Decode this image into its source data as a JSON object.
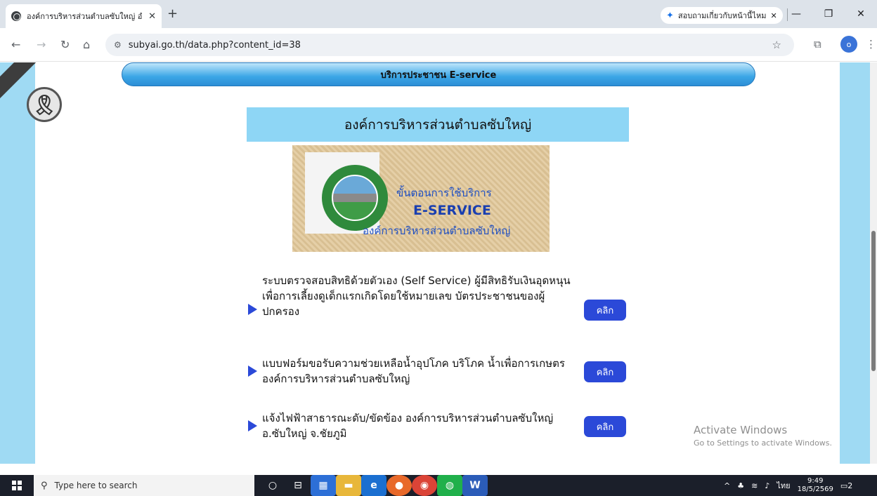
{
  "browser": {
    "tab_title": "องค์การบริหารส่วนตำบลซับใหญ่ อำเ",
    "tab_close": "✕",
    "new_tab": "+",
    "gemini_chip": "สอบถามเกี่ยวกับหน้านี้ไหม",
    "gemini_close": "✕",
    "url": "subyai.go.th/data.php?content_id=38",
    "profile_initial": "o"
  },
  "page": {
    "eservice_bar": "บริการประชาชน E-service",
    "org_header": "องค์การบริหารส่วนตำบลซับใหญ่",
    "banner": {
      "line1": "ขั้นตอนการใช้บริการ",
      "line2": "E-SERVICE",
      "line3": "องค์การบริหารส่วนตำบลซับใหญ่"
    },
    "services": [
      {
        "text": "ระบบตรวจสอบสิทธิด้วยตัวเอง (Self Service) ผู้มีสิทธิรับเงินอุดหนุน เพื่อการเลี้ยงดูเด็กแรกเกิดโดยใช้หมายเลข บัตรประชาชนของผู้ปกครอง",
        "button": "คลิก"
      },
      {
        "text": "แบบฟอร์มขอรับความช่วยเหลือน้ำอุปโภค บริโภค น้ำเพื่อการเกษตร องค์การบริหารส่วนตำบลซับใหญ่",
        "button": "คลิก"
      },
      {
        "text": "แจ้งไฟฟ้าสาธารณะดับ/ขัดข้อง องค์การบริหารส่วนตำบลซับใหญ่ อ.ซับใหญ่ จ.ชัยภูมิ",
        "button": "คลิก"
      }
    ],
    "ribbon_glyph": "🎗"
  },
  "watermark": {
    "title": "Activate Windows",
    "subtitle": "Go to Settings to activate Windows."
  },
  "taskbar": {
    "search_placeholder": "Type here to search",
    "lang": "ไทย",
    "time": "9:49",
    "date": "18/5/2569",
    "notif_count": "2"
  }
}
